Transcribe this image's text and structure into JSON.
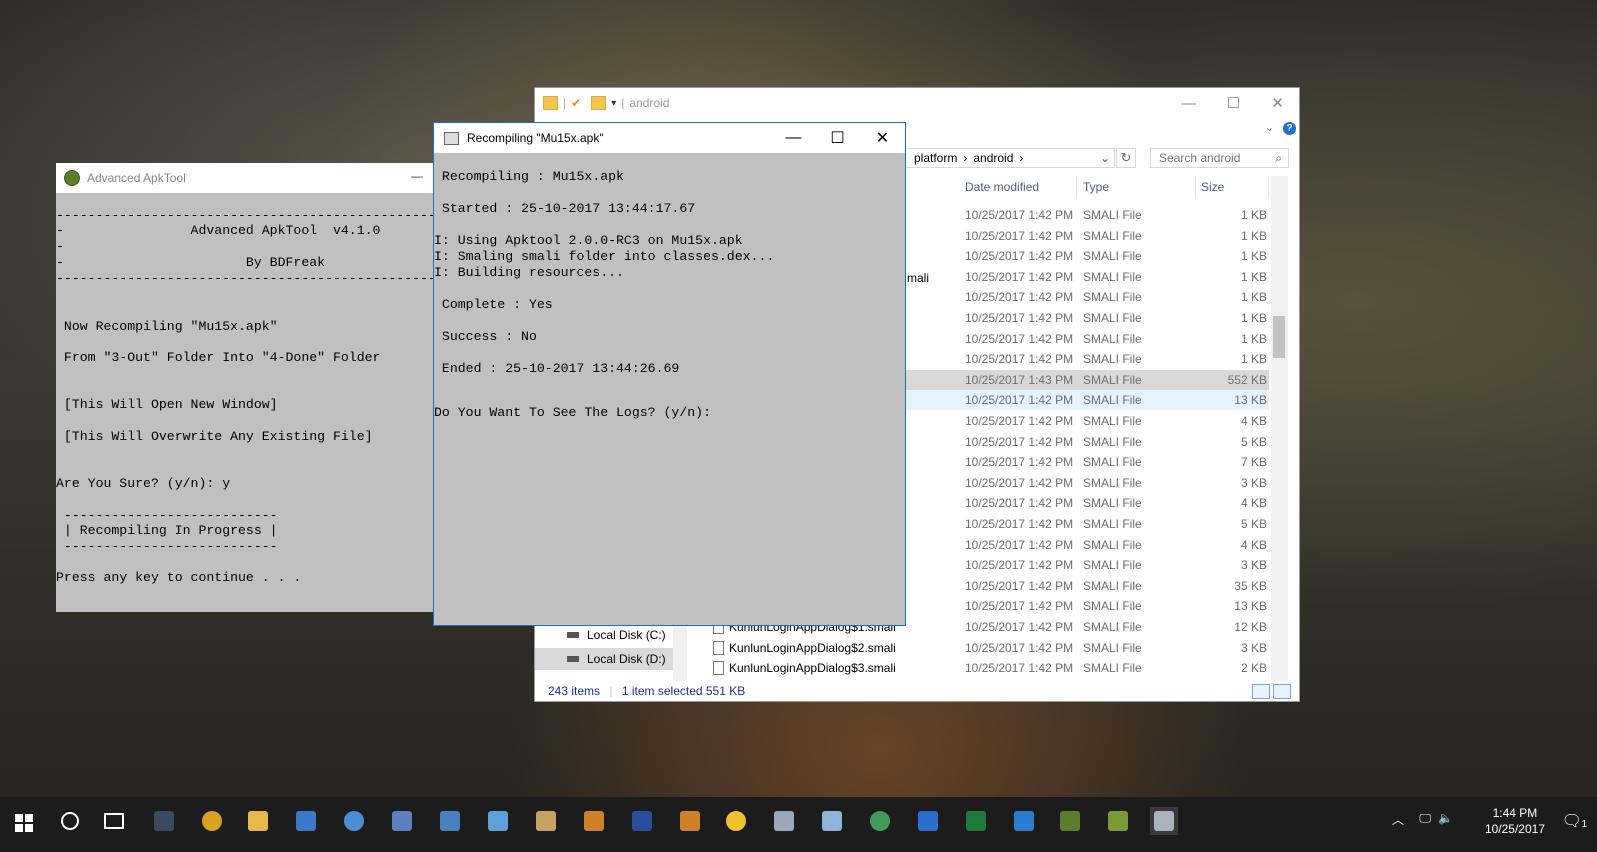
{
  "apktool_window": {
    "title": "Advanced ApkTool",
    "minimize": "—",
    "console_lines": [
      "-------------------------------------------------------",
      "-                Advanced ApkTool  v4.1.0              -",
      "-",
      "-                       By BDFreak                     -",
      "-------------------------------------------------------",
      "",
      "",
      " Now Recompiling \"Mu15x.apk\"",
      "",
      " From \"3-Out\" Folder Into \"4-Done\" Folder",
      "",
      "",
      " [This Will Open New Window]",
      "",
      " [This Will Overwrite Any Existing File]",
      "",
      "",
      "Are You Sure? (y/n): y",
      "",
      " ---------------------------",
      " | Recompiling In Progress |",
      " ---------------------------",
      "",
      "Press any key to continue . . ."
    ]
  },
  "recompile_window": {
    "title": "Recompiling \"Mu15x.apk\"",
    "controls": {
      "minimize": "—",
      "maximize": "☐",
      "close": "✕"
    },
    "console_lines": [
      "",
      " Recompiling : Mu15x.apk",
      "",
      " Started : 25-10-2017 13:44:17.67",
      "",
      "I: Using Apktool 2.0.0-RC3 on Mu15x.apk",
      "I: Smaling smali folder into classes.dex...",
      "I: Building resources...",
      "",
      " Complete : Yes",
      "",
      " Success : No",
      "",
      " Ended : 25-10-2017 13:44:26.69",
      "",
      "",
      "Do You Want To See The Logs? (y/n):"
    ]
  },
  "explorer": {
    "title": "android",
    "controls": {
      "minimize": "—",
      "maximize": "☐",
      "close": "✕"
    },
    "help": "?",
    "address": [
      "platform",
      "›",
      "android",
      "›"
    ],
    "search_placeholder": "Search android",
    "columns": {
      "date": "Date modified",
      "type": "Type",
      "size": "Size"
    },
    "partial_name": "mali",
    "rows": [
      {
        "date": "10/25/2017 1:42 PM",
        "type": "SMALI File",
        "size": "1 KB"
      },
      {
        "date": "10/25/2017 1:42 PM",
        "type": "SMALI File",
        "size": "1 KB"
      },
      {
        "date": "10/25/2017 1:42 PM",
        "type": "SMALI File",
        "size": "1 KB"
      },
      {
        "date": "10/25/2017 1:42 PM",
        "type": "SMALI File",
        "size": "1 KB"
      },
      {
        "date": "10/25/2017 1:42 PM",
        "type": "SMALI File",
        "size": "1 KB"
      },
      {
        "date": "10/25/2017 1:42 PM",
        "type": "SMALI File",
        "size": "1 KB"
      },
      {
        "date": "10/25/2017 1:42 PM",
        "type": "SMALI File",
        "size": "1 KB"
      },
      {
        "date": "10/25/2017 1:42 PM",
        "type": "SMALI File",
        "size": "1 KB"
      },
      {
        "date": "10/25/2017 1:43 PM",
        "type": "SMALI File",
        "size": "552 KB"
      },
      {
        "date": "10/25/2017 1:42 PM",
        "type": "SMALI File",
        "size": "13 KB"
      },
      {
        "date": "10/25/2017 1:42 PM",
        "type": "SMALI File",
        "size": "4 KB"
      },
      {
        "date": "10/25/2017 1:42 PM",
        "type": "SMALI File",
        "size": "5 KB"
      },
      {
        "date": "10/25/2017 1:42 PM",
        "type": "SMALI File",
        "size": "7 KB"
      },
      {
        "date": "10/25/2017 1:42 PM",
        "type": "SMALI File",
        "size": "3 KB"
      },
      {
        "date": "10/25/2017 1:42 PM",
        "type": "SMALI File",
        "size": "4 KB"
      },
      {
        "date": "10/25/2017 1:42 PM",
        "type": "SMALI File",
        "size": "5 KB"
      },
      {
        "date": "10/25/2017 1:42 PM",
        "type": "SMALI File",
        "size": "4 KB"
      },
      {
        "date": "10/25/2017 1:42 PM",
        "type": "SMALI File",
        "size": "3 KB"
      },
      {
        "date": "10/25/2017 1:42 PM",
        "type": "SMALI File",
        "size": "35 KB"
      },
      {
        "date": "10/25/2017 1:42 PM",
        "type": "SMALI File",
        "size": "13 KB"
      },
      {
        "name": "KunlunLoginAppDialog$1.smali",
        "date": "10/25/2017 1:42 PM",
        "type": "SMALI File",
        "size": "12 KB"
      },
      {
        "name": "KunlunLoginAppDialog$2.smali",
        "date": "10/25/2017 1:42 PM",
        "type": "SMALI File",
        "size": "3 KB"
      },
      {
        "name": "KunlunLoginAppDialog$3.smali",
        "date": "10/25/2017 1:42 PM",
        "type": "SMALI File",
        "size": "2 KB"
      }
    ],
    "nav": [
      {
        "label": "Local Disk (C:)",
        "selected": false
      },
      {
        "label": "Local Disk (D:)",
        "selected": true
      }
    ],
    "status": {
      "count": "243 items",
      "selected": "1 item selected  551 KB"
    }
  },
  "taskbar": {
    "time": "1:44 PM",
    "date": "10/25/2017",
    "notification_count": "1",
    "icons": [
      "windows-start-icon",
      "cortana-icon",
      "task-view-icon",
      "pox-icon",
      "chrome-icon",
      "file-explorer-icon",
      "remote-desktop-icon",
      "globe-icon",
      "vb-icon",
      "network-icon",
      "network-share-icon",
      "tools-icon",
      "gear-game-icon",
      "calculator-grid-icon",
      "gear-game-2-icon",
      "emoji-icon",
      "console-icon",
      "notepad-icon",
      "earth-icon",
      "shield-icon",
      "excel-icon",
      "edge-icon",
      "apktool-icon",
      "editor-icon",
      "cmd-icon"
    ]
  }
}
